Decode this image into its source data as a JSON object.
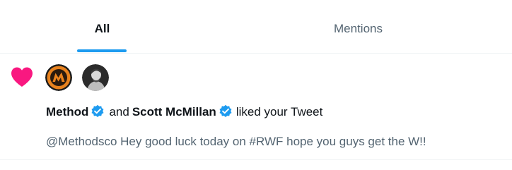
{
  "tabs": [
    {
      "label": "All",
      "selected": true
    },
    {
      "label": "Mentions",
      "selected": false
    }
  ],
  "notification": {
    "type_icon": "heart-icon",
    "icon_color": "#f91880",
    "avatars": [
      "Method",
      "Scott McMillan"
    ],
    "user1": "Method",
    "connector": "and",
    "user2": "Scott McMillan",
    "action": "liked your Tweet",
    "tweet_text": "@Methodsco Hey good luck today on #RWF hope you guys get the W!!"
  },
  "colors": {
    "accent": "#1d9bf0",
    "secondary_text": "#536471",
    "primary_text": "#0f1419"
  }
}
